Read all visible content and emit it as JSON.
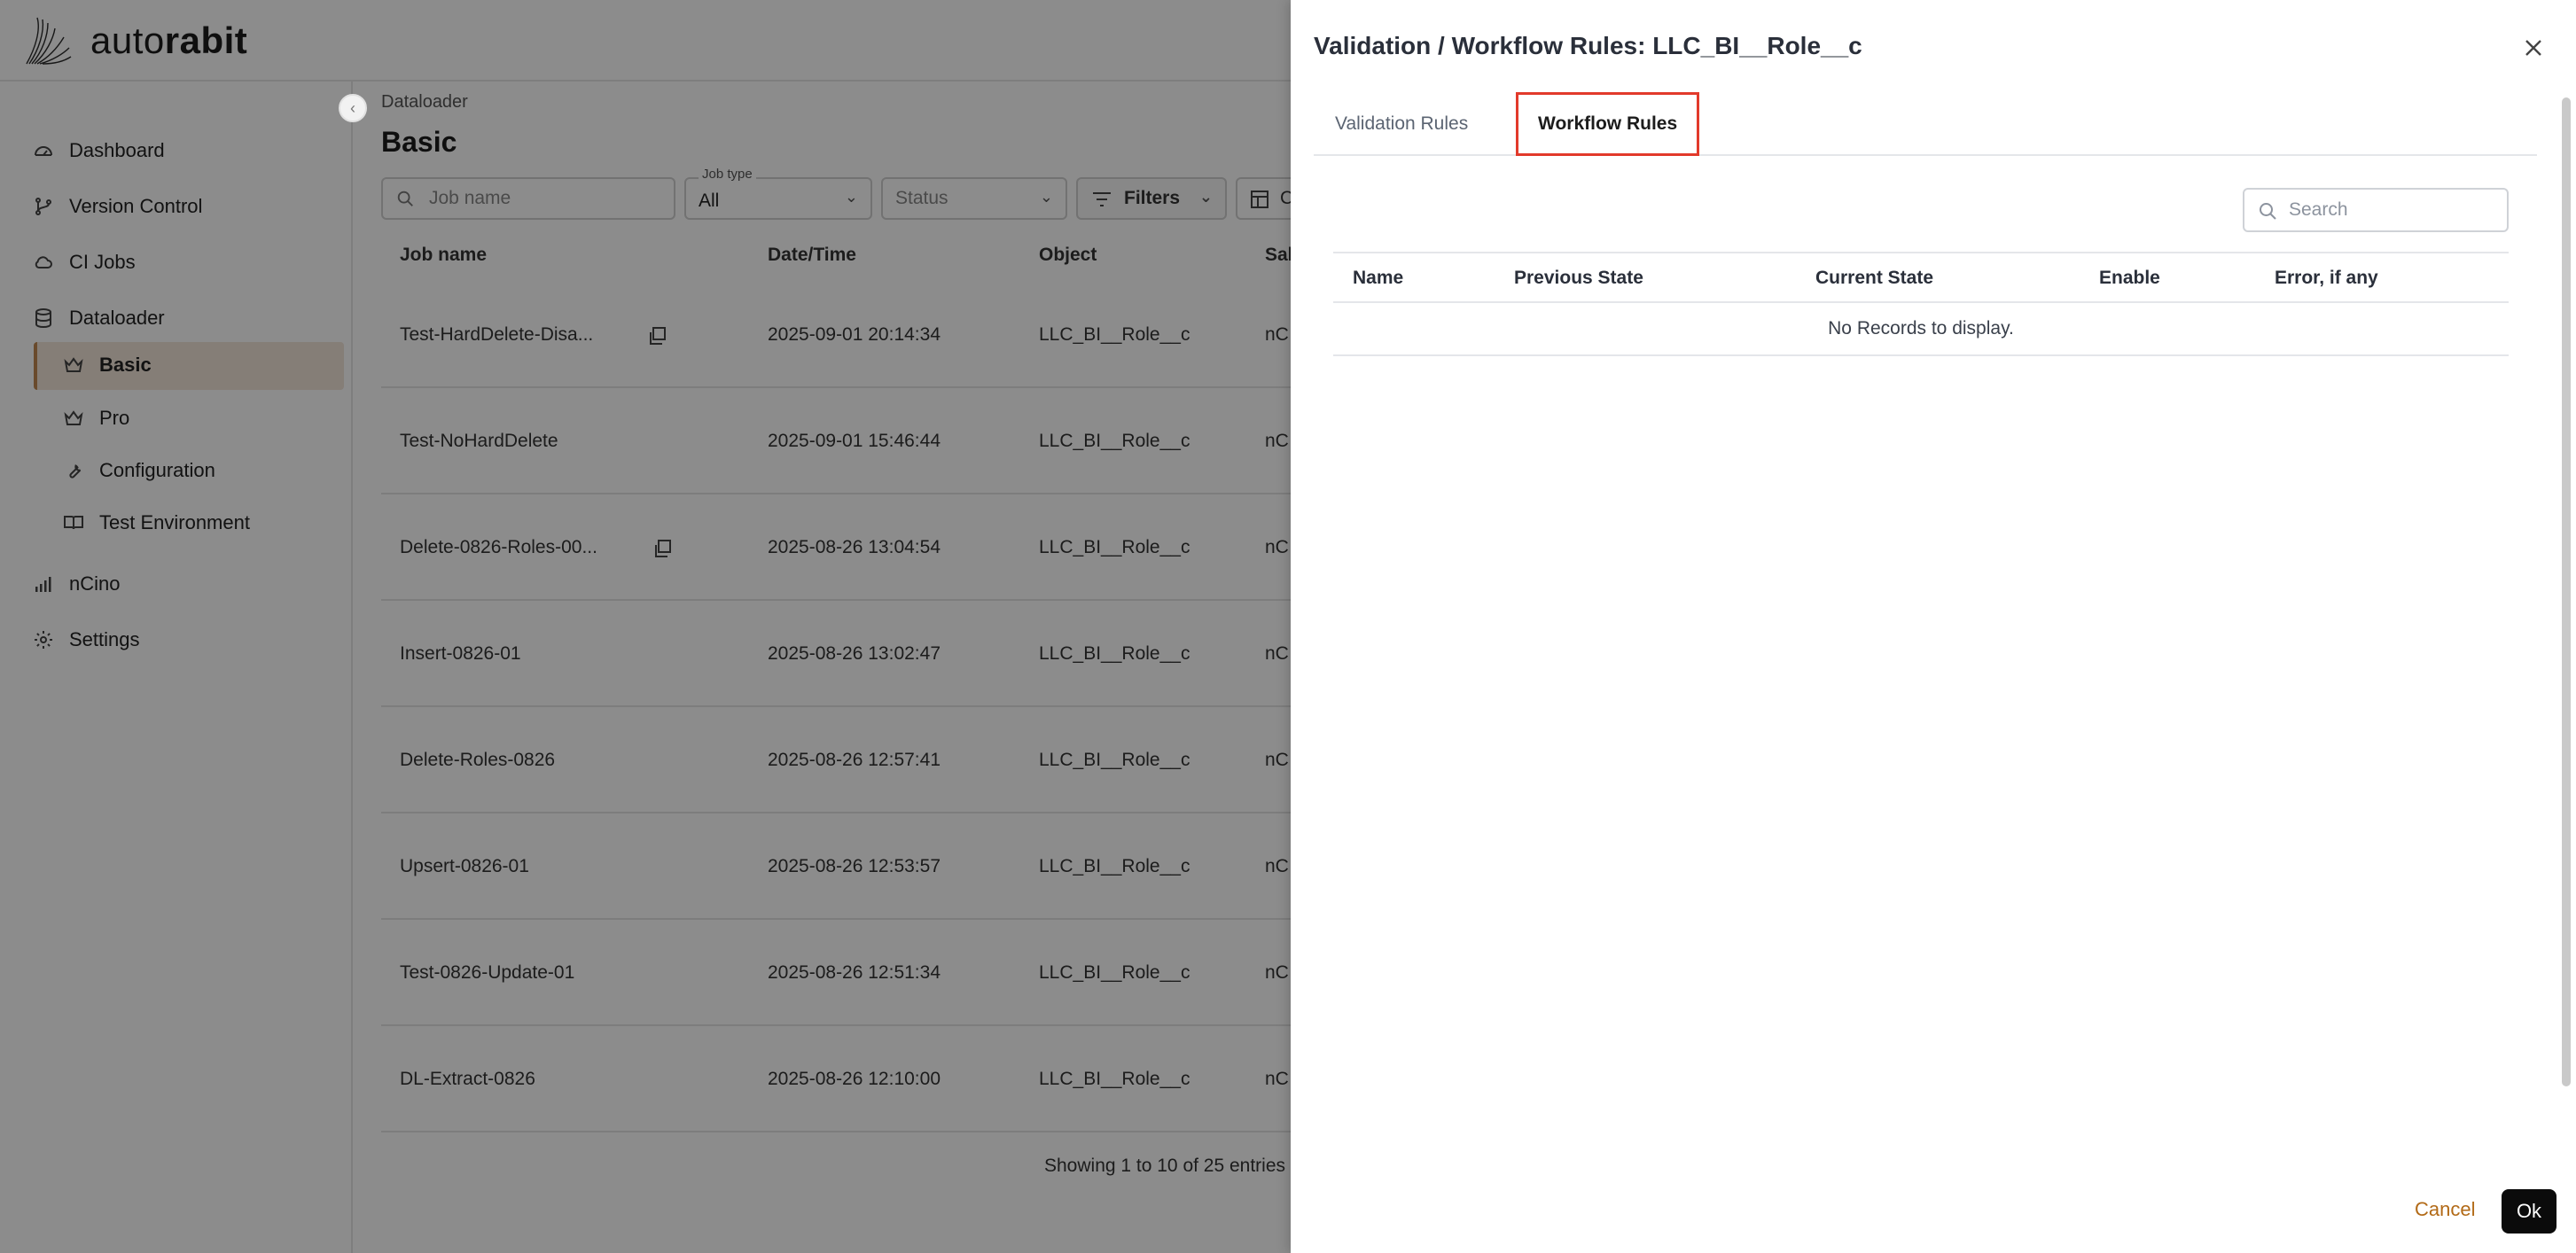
{
  "app": {
    "logo_text_light": "auto",
    "logo_text_bold": "rabit"
  },
  "sidebar": {
    "items": [
      {
        "label": "Dashboard",
        "icon": "dashboard-gauge-icon"
      },
      {
        "label": "Version Control",
        "icon": "git-branch-icon"
      },
      {
        "label": "CI Jobs",
        "icon": "cloud-icon"
      },
      {
        "label": "Dataloader",
        "icon": "database-icon"
      },
      {
        "label": "Basic",
        "icon": "crown-icon"
      },
      {
        "label": "Pro",
        "icon": "crown-icon"
      },
      {
        "label": "Configuration",
        "icon": "wrench-icon"
      },
      {
        "label": "Test Environment",
        "icon": "book-icon"
      },
      {
        "label": "nCino",
        "icon": "bar-chart-icon"
      },
      {
        "label": "Settings",
        "icon": "gear-icon"
      }
    ]
  },
  "main": {
    "breadcrumb": "Dataloader",
    "title": "Basic",
    "filters": {
      "job_name_placeholder": "Job name",
      "job_type_label": "Job type",
      "job_type_value": "All",
      "status_placeholder": "Status",
      "filters_label": "Filters",
      "columns_label": "C"
    },
    "columns": [
      "Job name",
      "Date/Time",
      "Object",
      "Sal"
    ],
    "rows": [
      {
        "name": "Test-HardDelete-Disa...",
        "datetime": "2025-09-01 20:14:34",
        "object": "LLC_BI__Role__c",
        "sal": "nC",
        "copy": true
      },
      {
        "name": "Test-NoHardDelete",
        "datetime": "2025-09-01 15:46:44",
        "object": "LLC_BI__Role__c",
        "sal": "nC",
        "copy": false
      },
      {
        "name": "Delete-0826-Roles-00...",
        "datetime": "2025-08-26 13:04:54",
        "object": "LLC_BI__Role__c",
        "sal": "nC",
        "copy": true
      },
      {
        "name": "Insert-0826-01",
        "datetime": "2025-08-26 13:02:47",
        "object": "LLC_BI__Role__c",
        "sal": "nC",
        "copy": false
      },
      {
        "name": "Delete-Roles-0826",
        "datetime": "2025-08-26 12:57:41",
        "object": "LLC_BI__Role__c",
        "sal": "nC",
        "copy": false
      },
      {
        "name": "Upsert-0826-01",
        "datetime": "2025-08-26 12:53:57",
        "object": "LLC_BI__Role__c",
        "sal": "nC",
        "copy": false
      },
      {
        "name": "Test-0826-Update-01",
        "datetime": "2025-08-26 12:51:34",
        "object": "LLC_BI__Role__c",
        "sal": "nC",
        "copy": false
      },
      {
        "name": "DL-Extract-0826",
        "datetime": "2025-08-26 12:10:00",
        "object": "LLC_BI__Role__c",
        "sal": "nC",
        "copy": false
      }
    ],
    "pager": "Showing 1 to 10 of 25 entries"
  },
  "drawer": {
    "title": "Validation / Workflow Rules: LLC_BI__Role__c",
    "tabs": [
      "Validation Rules",
      "Workflow Rules"
    ],
    "active_tab": "Workflow Rules",
    "search_placeholder": "Search",
    "columns": [
      "Name",
      "Previous State",
      "Current State",
      "Enable",
      "Error, if any"
    ],
    "empty_message": "No Records to display.",
    "cancel_label": "Cancel",
    "ok_label": "Ok"
  },
  "colors": {
    "accent_brown": "#b26a17",
    "active_tab_border": "#e23a2b",
    "sidebar_active_bg": "#f3e6d9",
    "ok_button_bg": "#0b0b0b"
  }
}
